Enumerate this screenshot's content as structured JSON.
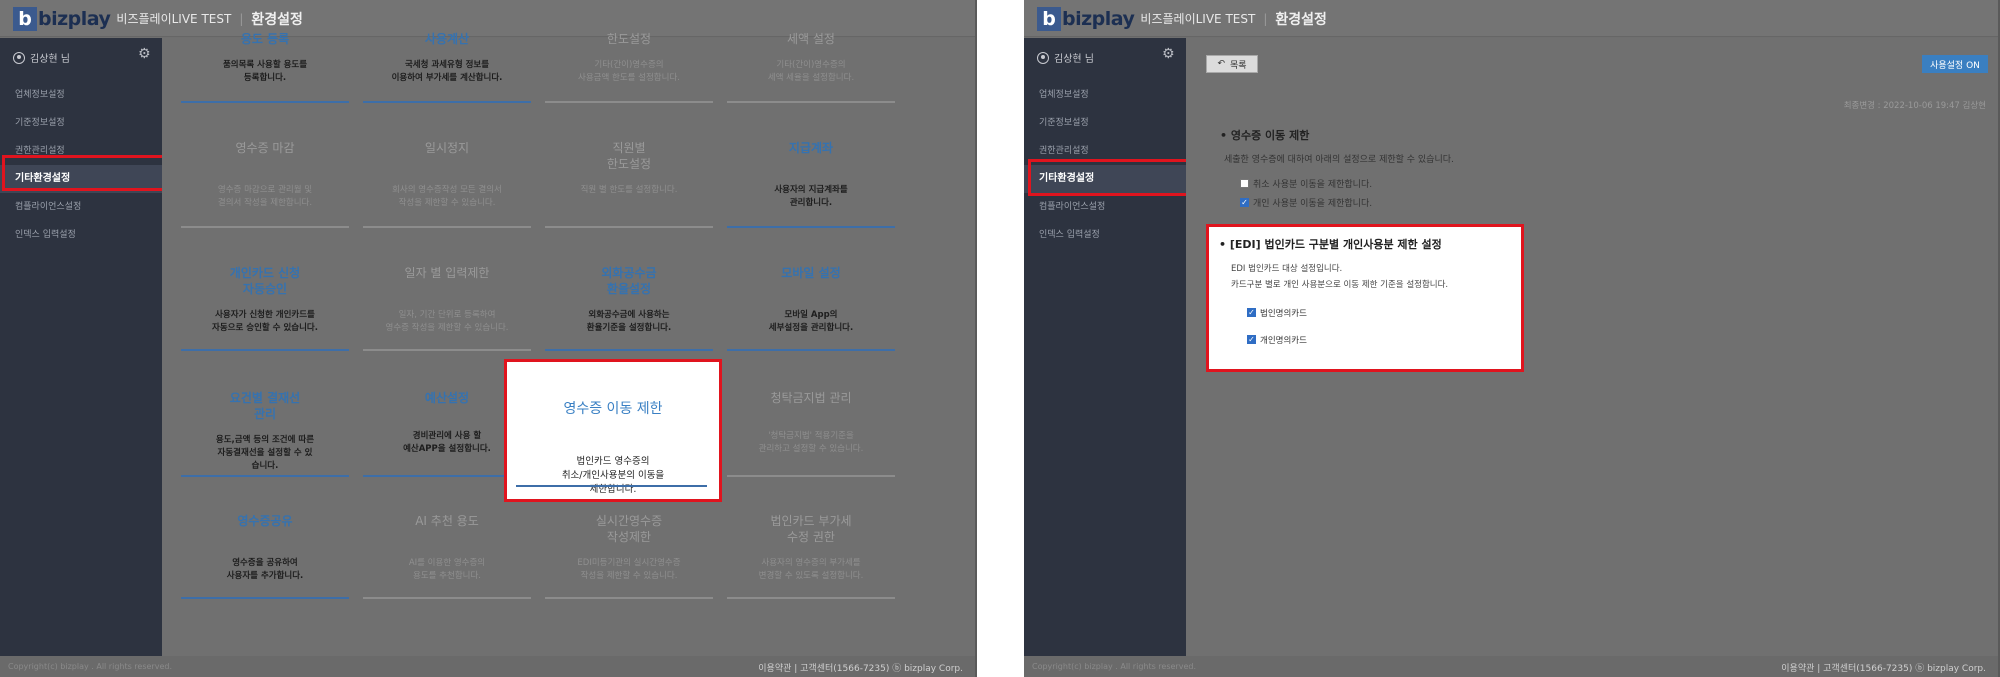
{
  "header": {
    "logo_text": "bizplay",
    "logo_letter": "b",
    "app_name": "비즈플레이LIVE TEST",
    "page_title": "환경설정"
  },
  "sidebar": {
    "user": "김상현 님",
    "items": [
      {
        "label": "업체정보설정"
      },
      {
        "label": "기준정보설정"
      },
      {
        "label": "권한관리설정"
      },
      {
        "label": "기타환경설정"
      },
      {
        "label": "컴플라이언스설정"
      },
      {
        "label": "인덱스 입력설정"
      }
    ]
  },
  "footer": {
    "copyright": "Copyright(c) bizplay . All rights reserved.",
    "links": "이용약관 | 고객센터(1566-7235) ⓑ bizplay Corp."
  },
  "tiles": {
    "r0": [
      {
        "title": "용도 등록",
        "desc": "품의목록 사용할 용도를\n등록합니다."
      },
      {
        "title": "사용계산",
        "desc": "국세청 과세유형 정보를\n이용하여 부가세를 계산합니다."
      },
      {
        "title": "한도설정",
        "desc": "기타(간이)영수증의\n사용금액 한도를 설정합니다."
      },
      {
        "title": "세액 설정",
        "desc": "기타(간이)영수증의\n세액 세율을 설정합니다."
      }
    ],
    "r1": [
      {
        "title": "영수증 마감",
        "desc": "영수증 마감으로 관리월 및\n결의서 작성을 제한합니다."
      },
      {
        "title": "일시정지",
        "desc": "회사의 영수증작성 모든 결의서\n작성을 제한할 수 있습니다."
      },
      {
        "title": "직원별\n한도설정",
        "desc": "직원 별 한도를 설정합니다."
      },
      {
        "title": "지급계좌",
        "desc": "사용자의 지급계좌를\n관리합니다."
      }
    ],
    "r2": [
      {
        "title": "개인카드 신청\n자동승인",
        "desc": "사용자가 신청한 개인카드를\n자동으로 승인할 수 있습니다."
      },
      {
        "title": "일자 별 입력제한",
        "desc": "일자, 기간 단위로 등록하여\n영수증 작성을 제한할 수 있습니다."
      },
      {
        "title": "외화공수금\n환율설정",
        "desc": "외화공수금에 사용하는\n환율기준을 설정합니다."
      },
      {
        "title": "모바일 설정",
        "desc": "모바일 App의\n세부설정을 관리합니다."
      }
    ],
    "r3": [
      {
        "title": "요건별 결재선\n관리",
        "desc": "용도,금액 등의 조건에 따른\n자동결재선을 설정할 수 있\n습니다."
      },
      {
        "title": "예산설정",
        "desc": "경비관리에 사용 할\n예산APP을 설정합니다."
      },
      {
        "title": "청탁금지법 관리",
        "desc": "'청탁금지법' 적용기준을\n관리하고 설정할 수 있습니다."
      }
    ],
    "r4": [
      {
        "title": "영수증공유",
        "desc": "영수증을 공유하여\n사용자를 추가합니다."
      },
      {
        "title": "AI 추천 용도",
        "desc": "AI를 이용한 영수증의\n용도를 추천합니다."
      },
      {
        "title": "실시간영수증\n작성제한",
        "desc": "EDI미등기관의 실시간영수증\n작성을 제한할 수 있습니다."
      },
      {
        "title": "법인카드 부가세\n수정 권한",
        "desc": "사용자의 영수증의 부가세를\n변경할 수 있도록 설정합니다."
      }
    ]
  },
  "popup": {
    "title": "영수증 이동 제한",
    "desc": "법인카드 영수증의\n취소/개인사용분의 이동을\n제한합니다."
  },
  "detail": {
    "back_label": "목록",
    "toggle_label": "사용설정 ON",
    "last_modified": "최종변경 : 2022-10-06 19:47 김상현",
    "section_title": "• 영수증 이동 제한",
    "section_desc": "세출한 영수증에 대하여 아래의 설정으로 제한할 수 있습니다.",
    "options": [
      {
        "label": "취소 사용분 이동을 제한합니다.",
        "checked": false
      },
      {
        "label": "개인 사용분 이동을 제한합니다.",
        "checked": true
      }
    ],
    "edi": {
      "title": "• [EDI] 법인카드 구분별 개인사용분 제한 설정",
      "line1": "EDI 법인카드 대상 설정입니다.",
      "line2": "카드구분 별로 개인 사용분으로 이동 제한 기준을 설정합니다.",
      "options": [
        {
          "label": "법인명의카드",
          "checked": true
        },
        {
          "label": "개인명의카드",
          "checked": true
        }
      ]
    }
  }
}
